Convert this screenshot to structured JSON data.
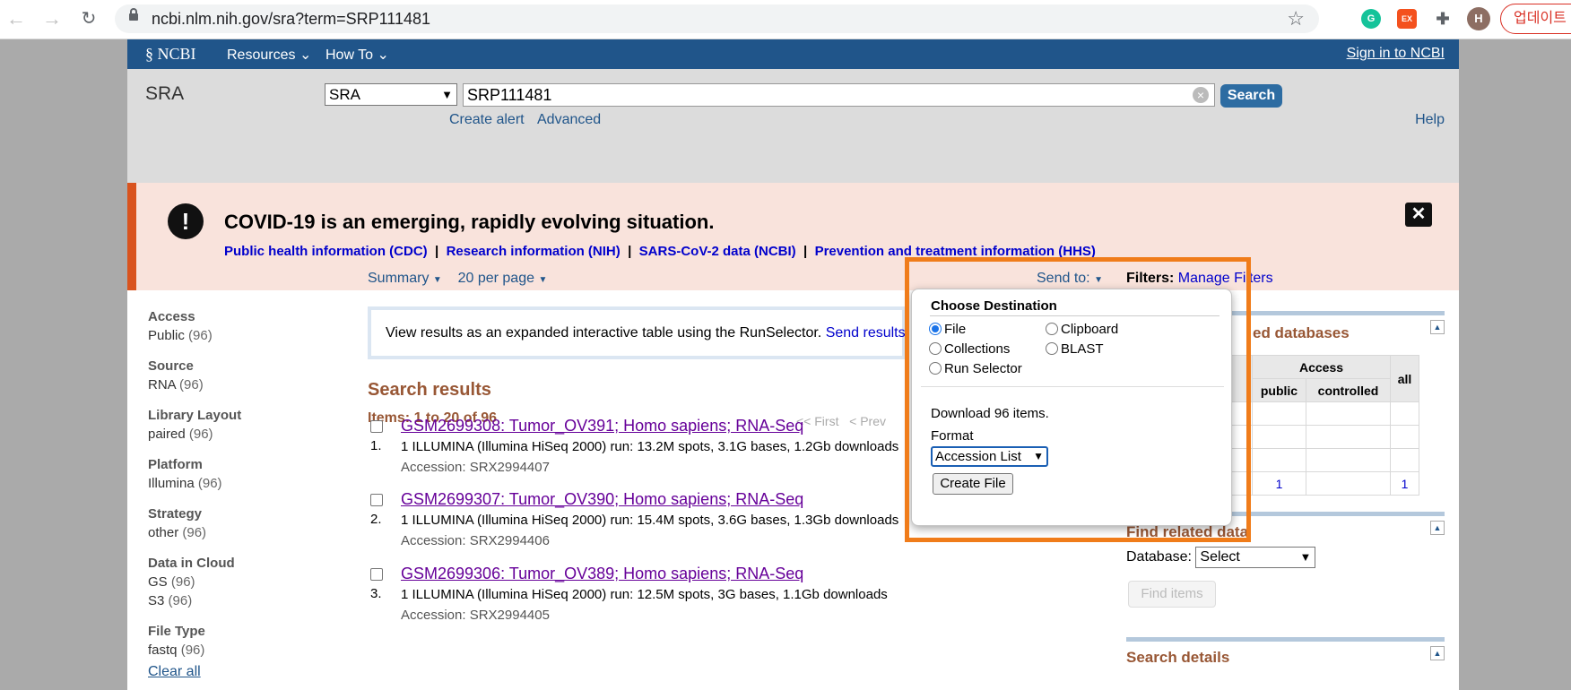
{
  "browser": {
    "url": "ncbi.nlm.nih.gov/sra?term=SRP111481",
    "profile_initial": "H",
    "update_label": "업데이트",
    "ext_ex": "EX"
  },
  "header": {
    "logo": "NCBI",
    "resources": "Resources",
    "howto": "How To",
    "signin": "Sign in to NCBI"
  },
  "search": {
    "db_title": "SRA",
    "db_selected": "SRA",
    "term": "SRP111481",
    "button": "Search",
    "create_alert": "Create alert",
    "advanced": "Advanced",
    "help": "Help"
  },
  "alert": {
    "heading": "COVID-19 is an emerging, rapidly evolving situation.",
    "links": [
      "Public health information (CDC)",
      "Research information (NIH)",
      "SARS-CoV-2 data (NCBI)",
      "Prevention and treatment information (HHS)"
    ],
    "sep": "|"
  },
  "facets": [
    {
      "title": "Access",
      "values": [
        {
          "label": "Public",
          "count": "(96)"
        }
      ]
    },
    {
      "title": "Source",
      "values": [
        {
          "label": "RNA",
          "count": "(96)"
        }
      ]
    },
    {
      "title": "Library Layout",
      "values": [
        {
          "label": "paired",
          "count": "(96)"
        }
      ]
    },
    {
      "title": "Platform",
      "values": [
        {
          "label": "Illumina",
          "count": "(96)"
        }
      ]
    },
    {
      "title": "Strategy",
      "values": [
        {
          "label": "other",
          "count": "(96)"
        }
      ]
    },
    {
      "title": "Data in Cloud",
      "values": [
        {
          "label": "GS",
          "count": "(96)"
        },
        {
          "label": "S3",
          "count": "(96)"
        }
      ]
    },
    {
      "title": "File Type",
      "values": [
        {
          "label": "fastq",
          "count": "(96)"
        }
      ]
    }
  ],
  "clear_all": "Clear all",
  "display": {
    "summary": "Summary",
    "per_page": "20 per page"
  },
  "banner": {
    "text": "View results as an expanded interactive table using the RunSelector.",
    "link": "Send results"
  },
  "results": {
    "heading": "Search results",
    "items": "Items: 1 to 20 of 96",
    "first": "<< First",
    "prev": "< Prev",
    "list": [
      {
        "num": "1.",
        "title": "GSM2699308: Tumor_OV391; Homo sapiens; RNA-Seq",
        "desc": "1 ILLUMINA (Illumina HiSeq 2000) run: 13.2M spots, 3.1G bases, 1.2Gb downloads",
        "acc": "Accession: SRX2994407"
      },
      {
        "num": "2.",
        "title": "GSM2699307: Tumor_OV390; Homo sapiens; RNA-Seq",
        "desc": "1 ILLUMINA (Illumina HiSeq 2000) run: 15.4M spots, 3.6G bases, 1.3Gb downloads",
        "acc": "Accession: SRX2994406"
      },
      {
        "num": "3.",
        "title": "GSM2699306: Tumor_OV389; Homo sapiens; RNA-Seq",
        "desc": "1 ILLUMINA (Illumina HiSeq 2000) run: 12.5M spots, 3G bases, 1.1Gb downloads",
        "acc": "Accession: SRX2994405"
      }
    ]
  },
  "right": {
    "send_to": "Send to:",
    "filters_label": "Filters:",
    "manage_filters": "Manage Filters",
    "related_db_tail": "ed databases",
    "access_header": "Access",
    "all_header": "all",
    "public": "public",
    "controlled": "controlled",
    "count_public": "1",
    "count_all": "1",
    "find_related": "Find related data",
    "database_label": "Database:",
    "database_selected": "Select",
    "find_items": "Find items",
    "search_details": "Search details"
  },
  "popup": {
    "title": "Choose Destination",
    "options": [
      "File",
      "Clipboard",
      "Collections",
      "BLAST",
      "Run Selector"
    ],
    "download": "Download 96 items.",
    "format_label": "Format",
    "format_selected": "Accession List",
    "create_file": "Create File"
  },
  "colors": {
    "ncbi_blue": "#20558a",
    "alert_orange": "#d9531e",
    "highlight": "#f07c1a",
    "result_brown": "#985735"
  }
}
